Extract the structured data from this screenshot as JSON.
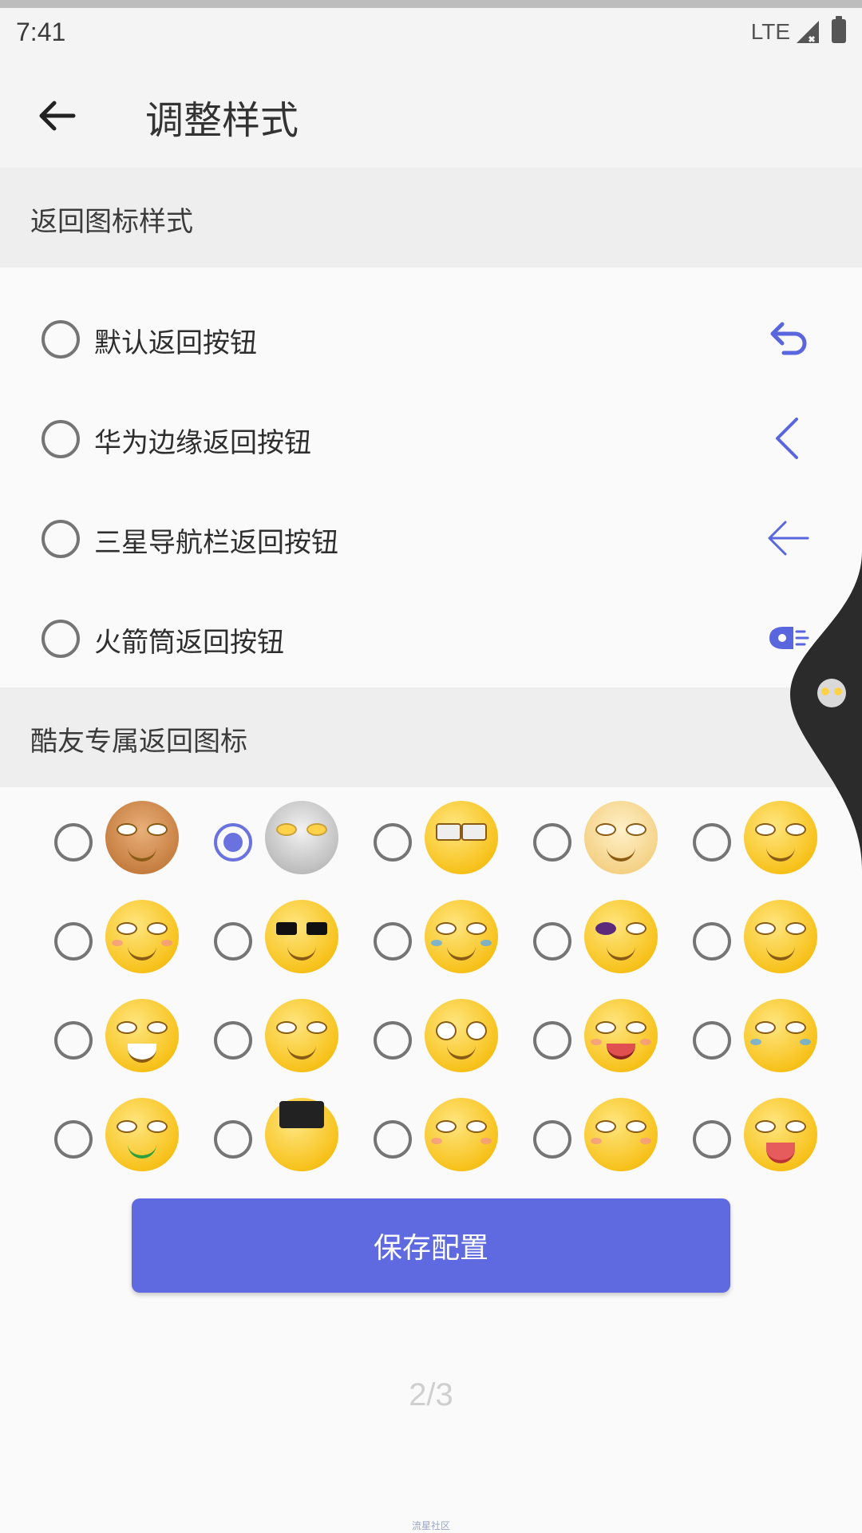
{
  "status_bar": {
    "time": "7:41",
    "network": "LTE"
  },
  "app_bar": {
    "title": "调整样式"
  },
  "sections": {
    "back_icon_style": "返回图标样式",
    "fan_icons": "酷友专属返回图标"
  },
  "options": [
    {
      "label": "默认返回按钮",
      "icon": "undo-arrow-icon",
      "checked": false
    },
    {
      "label": "华为边缘返回按钮",
      "icon": "chevron-left-icon",
      "checked": false
    },
    {
      "label": "三星导航栏返回按钮",
      "icon": "arrow-left-icon",
      "checked": false
    },
    {
      "label": "火箭筒返回按钮",
      "icon": "rocket-icon",
      "checked": false
    }
  ],
  "emoji_icons": [
    {
      "name": "cow-beer-icon",
      "checked": false
    },
    {
      "name": "ultraman-icon",
      "checked": true
    },
    {
      "name": "sunglasses-hand-icon",
      "checked": false
    },
    {
      "name": "doge-icon",
      "checked": false
    },
    {
      "name": "smirk-icon",
      "checked": false
    },
    {
      "name": "smile-icon",
      "checked": false
    },
    {
      "name": "cool-glasses-icon",
      "checked": false
    },
    {
      "name": "tears-of-joy-icon",
      "checked": false
    },
    {
      "name": "black-eye-icon",
      "checked": false
    },
    {
      "name": "bandage-head-icon",
      "checked": false
    },
    {
      "name": "grin-icon",
      "checked": false
    },
    {
      "name": "skeptical-icon",
      "checked": false
    },
    {
      "name": "confused-icon",
      "checked": false
    },
    {
      "name": "tongue-icon",
      "checked": false
    },
    {
      "name": "crying-icon",
      "checked": false
    },
    {
      "name": "watermelon-icon",
      "checked": false
    },
    {
      "name": "10t-weight-icon",
      "checked": false
    },
    {
      "name": "whisper-icon",
      "checked": false
    },
    {
      "name": "blow-kiss-icon",
      "checked": false
    },
    {
      "name": "fan-face-icon",
      "checked": false
    }
  ],
  "save_button": "保存配置",
  "pager": "2/3",
  "watermark": "流星社区",
  "colors": {
    "accent": "#5f6ae0",
    "icon_blue": "#5a66dd",
    "header_bg": "#eeeeee"
  }
}
